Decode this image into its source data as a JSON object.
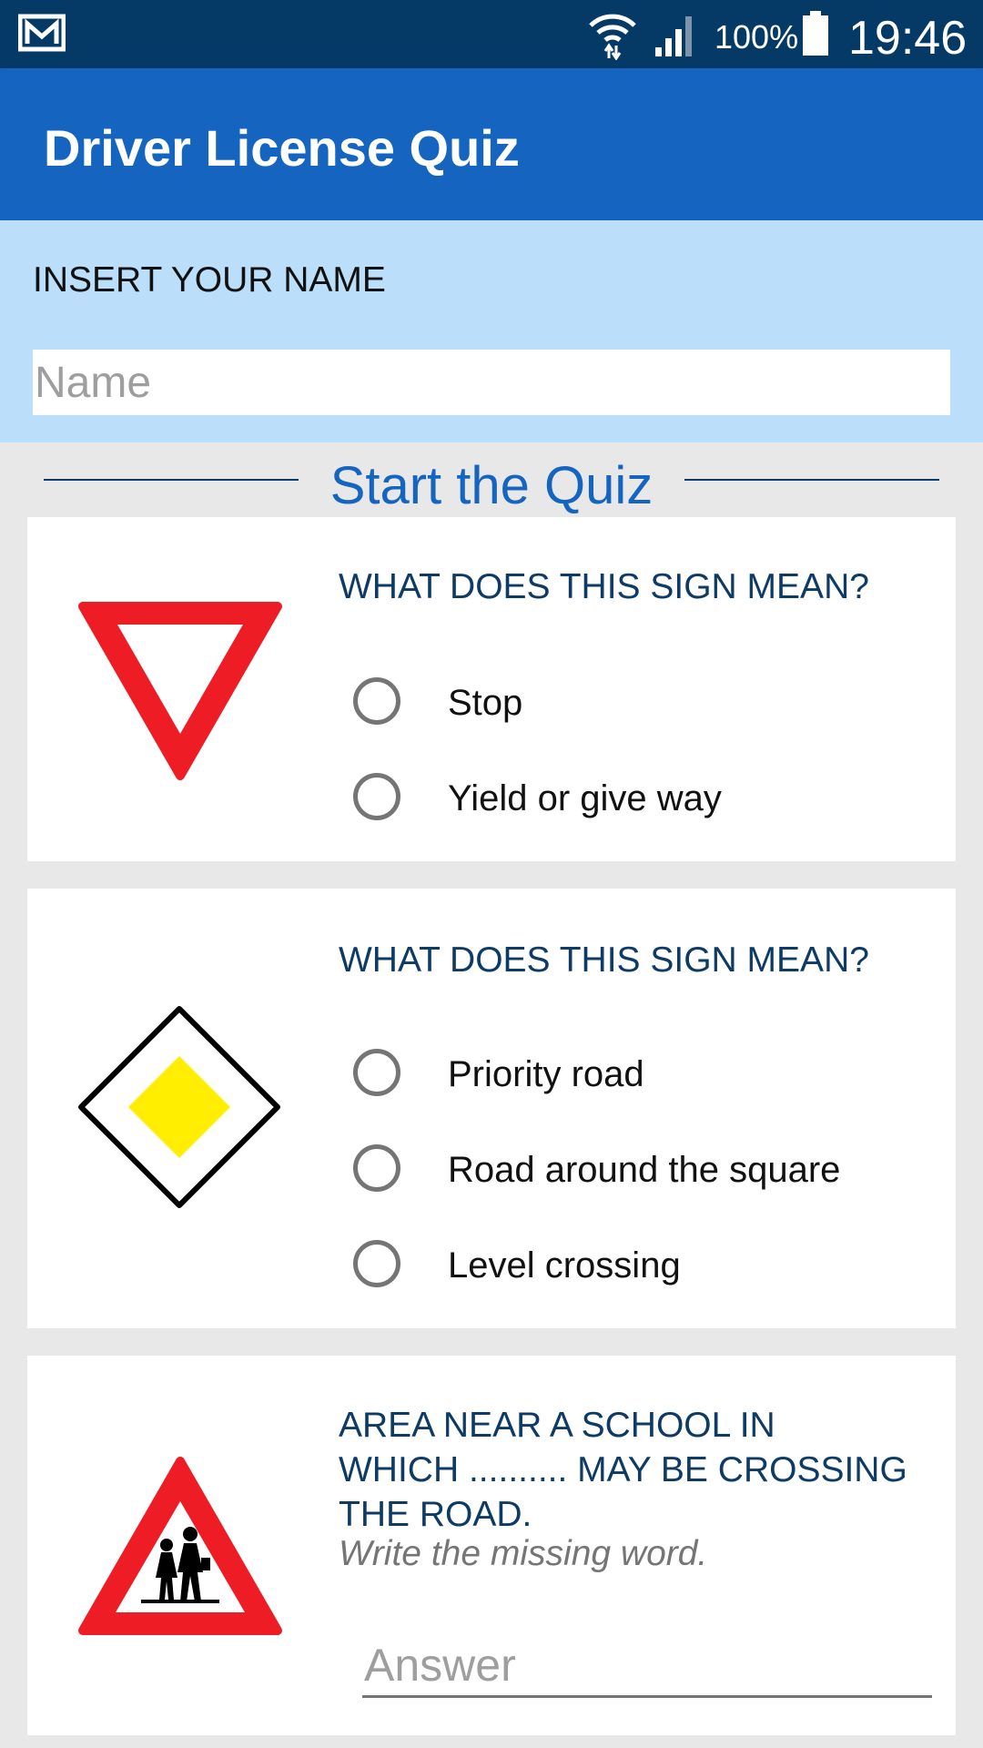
{
  "status_bar": {
    "battery_text": "100%",
    "time": "19:46",
    "icons": [
      "gmail-icon",
      "wifi-icon",
      "signal-icon",
      "battery-icon"
    ]
  },
  "app_bar": {
    "title": "Driver License Quiz",
    "color": "#1565c0"
  },
  "name_section": {
    "label": "INSERT YOUR NAME",
    "input": {
      "placeholder": "Name",
      "value": ""
    }
  },
  "start": {
    "title": "Start the Quiz"
  },
  "questions": [
    {
      "question": "WHAT DOES THIS SIGN MEAN?",
      "sign": "yield-sign-icon",
      "options": [
        "Stop",
        "Yield or give way"
      ]
    },
    {
      "question": "WHAT DOES THIS SIGN MEAN?",
      "sign": "priority-road-sign-icon",
      "options": [
        "Priority road",
        "Road around the square",
        "Level crossing"
      ]
    },
    {
      "question_lines": [
        "AREA NEAR A SCHOOL IN",
        "WHICH .......... MAY BE CROSSING",
        "THE ROAD."
      ],
      "hint": "Write the missing word.",
      "sign": "children-crossing-sign-icon",
      "answer_placeholder": "Answer"
    }
  ],
  "colors": {
    "status_bar": "#063a66",
    "background": "#e8e8e8",
    "name_section": "#bbdefb",
    "question_text": "#0d3b66",
    "sign_red": "#ee1c25",
    "sign_yellow": "#ffee00"
  }
}
